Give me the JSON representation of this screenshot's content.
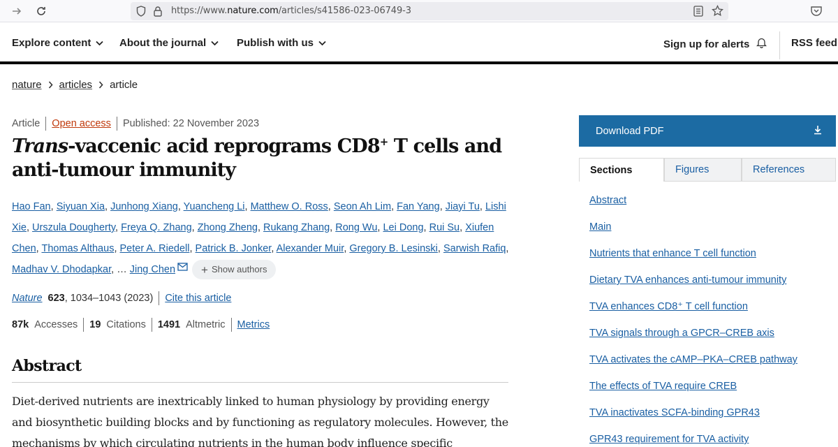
{
  "browser": {
    "url_prefix": "https://www.",
    "url_host": "nature.com",
    "url_path": "/articles/s41586-023-06749-3",
    "icons": [
      "arrow-right-icon",
      "refresh-icon",
      "shield-icon",
      "lock-icon",
      "reader-view-icon",
      "star-icon",
      "pocket-icon"
    ]
  },
  "site_nav": {
    "explore": "Explore content",
    "about": "About the journal",
    "publish": "Publish with us",
    "alerts": "Sign up for alerts",
    "rss": "RSS feed"
  },
  "breadcrumb": [
    "nature",
    "articles",
    "article"
  ],
  "article": {
    "type": "Article",
    "access": "Open access",
    "published": "Published: 22 November 2023",
    "title_italic": "Trans",
    "title_part1": "-vaccenic acid reprograms CD8",
    "title_sup": "+",
    "title_part2": " T cells and anti-tumour immunity",
    "authors": [
      "Hao Fan",
      "Siyuan Xia",
      "Junhong Xiang",
      "Yuancheng Li",
      "Matthew O. Ross",
      "Seon Ah Lim",
      "Fan Yang",
      "Jiayi Tu",
      "Lishi Xie",
      "Urszula Dougherty",
      "Freya Q. Zhang",
      "Zhong Zheng",
      "Rukang Zhang",
      "Rong Wu",
      "Lei Dong",
      "Rui Su",
      "Xiufen Chen",
      "Thomas Althaus",
      "Peter A. Riedell",
      "Patrick B. Jonker",
      "Alexander Muir",
      "Gregory B. Lesinski",
      "Sarwish Rafiq",
      "Madhav V. Dhodapkar"
    ],
    "ellipsis": "…",
    "last_author": "Jing Chen",
    "show_authors": "Show authors",
    "journal": "Nature",
    "volume": "623",
    "pages_year": ", 1034–1043 (2023)",
    "cite": "Cite this article",
    "accesses_value": "87k",
    "accesses_label": "Accesses",
    "citations_value": "19",
    "citations_label": "Citations",
    "altmetric_value": "1491",
    "altmetric_label": "Altmetric",
    "metrics_link": "Metrics"
  },
  "abstract": {
    "heading": "Abstract",
    "text": "Diet-derived nutrients are inextricably linked to human physiology by providing energy and biosynthetic building blocks and by functioning as regulatory molecules. However, the mechanisms by which circulating nutrients in the human body influence specific"
  },
  "sidebar": {
    "download": "Download PDF",
    "tabs": [
      "Sections",
      "Figures",
      "References"
    ],
    "sections": [
      "Abstract",
      "Main",
      "Nutrients that enhance T cell function",
      "Dietary TVA enhances anti-tumour immunity",
      "TVA enhances CD8⁺ T cell function",
      "TVA signals through a GPCR–CREB axis",
      "TVA activates the cAMP–PKA–CREB pathway",
      "The effects of TVA require CREB",
      "TVA inactivates SCFA-binding GPR43",
      "GPR43 requirement for TVA activity"
    ]
  },
  "colors": {
    "link": "#1a5fa3",
    "open_access": "#c0390b",
    "download_bg": "#1c6ba3",
    "nav_rule": "#000000"
  }
}
